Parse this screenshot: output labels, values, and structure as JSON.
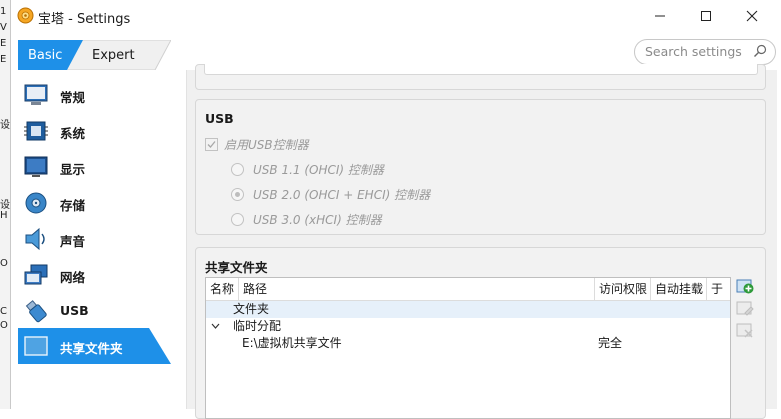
{
  "background": {
    "chars": [
      "1",
      "V",
      "E",
      "E",
      "设",
      "H",
      "O",
      "C",
      "O"
    ]
  },
  "window": {
    "title": "宝塔 - Settings"
  },
  "mode_tabs": {
    "basic": "Basic",
    "expert": "Expert",
    "active": "Basic"
  },
  "search": {
    "placeholder": "Search settings",
    "value": ""
  },
  "sidebar": {
    "items": [
      {
        "label": "常规",
        "icon": "general-monitor-icon"
      },
      {
        "label": "系统",
        "icon": "system-chip-icon"
      },
      {
        "label": "显示",
        "icon": "display-monitor-icon"
      },
      {
        "label": "存储",
        "icon": "storage-disk-icon"
      },
      {
        "label": "声音",
        "icon": "audio-speaker-icon"
      },
      {
        "label": "网络",
        "icon": "network-icon"
      },
      {
        "label": "USB",
        "icon": "usb-icon"
      },
      {
        "label": "共享文件夹",
        "icon": "shared-folder-icon"
      }
    ],
    "selected": "共享文件夹"
  },
  "usb": {
    "title": "USB",
    "enable_label": "启用USB控制器",
    "enabled": true,
    "options": [
      {
        "label": "USB 1.1 (OHCI) 控制器",
        "selected": false
      },
      {
        "label": "USB 2.0 (OHCI + EHCI) 控制器",
        "selected": true
      },
      {
        "label": "USB 3.0 (xHCI) 控制器",
        "selected": false
      }
    ]
  },
  "shared_folders": {
    "title": "共享文件夹",
    "columns": [
      "名称",
      "路径",
      "访问权限",
      "自动挂载",
      "于"
    ],
    "rows": [
      {
        "name": "文件夹",
        "path": "",
        "access": "",
        "automount": "",
        "at": ""
      },
      {
        "name": "临时分配",
        "path": "",
        "access": "",
        "automount": "",
        "at": ""
      },
      {
        "name": "",
        "path": "E:\\虚拟机共享文件",
        "access": "完全",
        "automount": "",
        "at": ""
      }
    ]
  },
  "colors": {
    "accent": "#1e90e8",
    "selection": "#1e90e8",
    "add_icon": "#2e9a3a"
  }
}
